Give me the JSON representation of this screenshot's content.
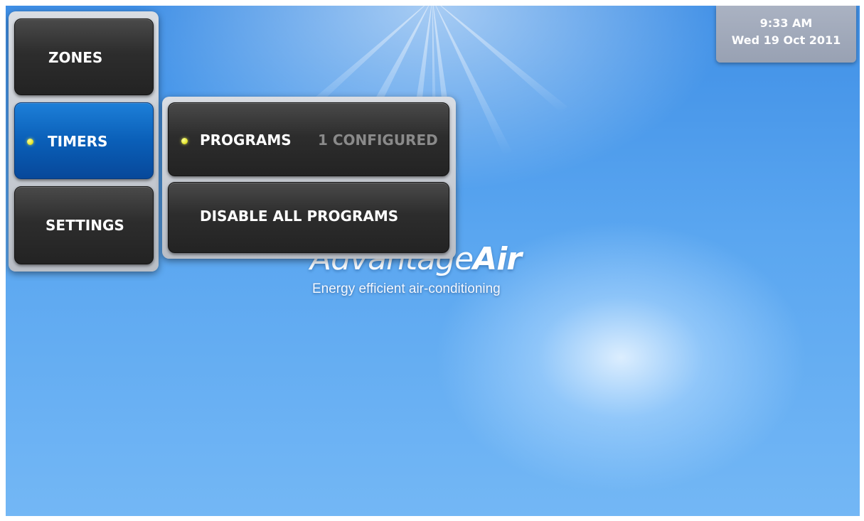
{
  "clock": {
    "time": "9:33 AM",
    "date": "Wed 19 Oct 2011"
  },
  "menu": {
    "zones_label": "ZONES",
    "timers_label": "TIMERS",
    "settings_label": "SETTINGS",
    "active_item": "TIMERS"
  },
  "submenu": {
    "programs_label": "PROGRAMS",
    "programs_status": "1 CONFIGURED",
    "disable_label": "DISABLE ALL PROGRAMS"
  },
  "brand": {
    "name_light": "Advantage",
    "name_bold": "Air",
    "tagline": "Energy efficient air-conditioning"
  },
  "colors": {
    "accent_blue": "#0a5fb8",
    "indicator_yellow": "#e5e62e",
    "button_dark": "#2d2d2d",
    "background_sky": "#5aa6f0"
  },
  "icons": {
    "active_indicator": "indicator-dot-icon"
  }
}
